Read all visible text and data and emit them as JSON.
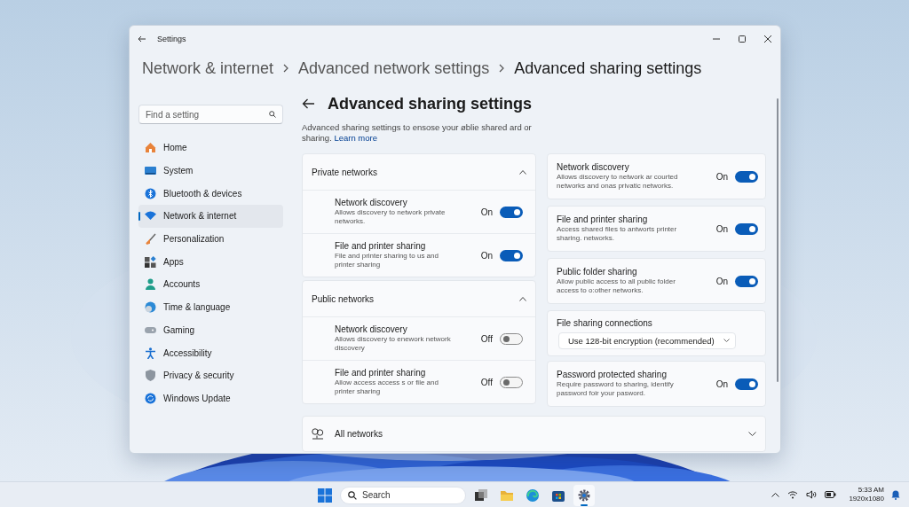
{
  "window": {
    "title": "Settings"
  },
  "breadcrumb": [
    "Network & internet",
    "Advanced network settings",
    "Advanced sharing settings"
  ],
  "sidebar": {
    "search": {
      "placeholder": "Find a setting"
    },
    "items": [
      {
        "label": "Home",
        "selected": false
      },
      {
        "label": "System",
        "selected": false
      },
      {
        "label": "Bluetooth & devices",
        "selected": false
      },
      {
        "label": "Network & internet",
        "selected": true
      },
      {
        "label": "Personalization",
        "selected": false
      },
      {
        "label": "Apps",
        "selected": false
      },
      {
        "label": "Accounts",
        "selected": false
      },
      {
        "label": "Time & language",
        "selected": false
      },
      {
        "label": "Gaming",
        "selected": false
      },
      {
        "label": "Accessibility",
        "selected": false
      },
      {
        "label": "Privacy & security",
        "selected": false
      },
      {
        "label": "Windows Update",
        "selected": false
      }
    ]
  },
  "page": {
    "title": "Advanced sharing settings",
    "description": "Advanced sharing settings to ensose your øblie shared ard or sharing.",
    "link": "Learn more"
  },
  "sections": [
    {
      "title": "Private networks",
      "expanded": true,
      "items": [
        {
          "title": "Network discovery",
          "description": "Allows discovery to network private networks.",
          "state_label": "On",
          "on": true
        },
        {
          "title": "File and printer sharing",
          "description": "File and printer sharing to us and printer sharing",
          "state_label": "On",
          "on": true
        }
      ]
    },
    {
      "title": "Public networks",
      "expanded": true,
      "items": [
        {
          "title": "Network discovery",
          "description": "Allows discovery to enework network discovery",
          "state_label": "Off",
          "on": false
        },
        {
          "title": "File and printer sharing",
          "description": "Allow access access s or file and printer sharing",
          "state_label": "Off",
          "on": false
        }
      ]
    }
  ],
  "cards": [
    {
      "kind": "toggle",
      "title": "Network discovery",
      "description": "Allows discovery to network ar courted networks and onas privatic networks.",
      "state_label": "On",
      "on": true
    },
    {
      "kind": "toggle",
      "title": "File and printer sharing",
      "description": "Access shared files to antworts printer sharing. networks.",
      "state_label": "On",
      "on": true
    },
    {
      "kind": "toggle",
      "title": "Public folder sharing",
      "description": "Allow public access to all public folder access to o:other networks.",
      "state_label": "On",
      "on": true
    },
    {
      "kind": "dropdown",
      "title": "File sharing connections",
      "value": "Use 128-bit encryption (recommended)"
    },
    {
      "kind": "toggle",
      "title": "Password protected sharing",
      "description": "Require password to sharing, identify password foir your pasword.",
      "state_label": "On",
      "on": true
    }
  ],
  "all_networks": {
    "title": "All networks",
    "expanded": false
  },
  "taskbar": {
    "search": {
      "placeholder": "Search"
    },
    "apps": [
      {
        "kind": "task-view",
        "selected": false
      },
      {
        "kind": "folder",
        "selected": false
      },
      {
        "kind": "browser",
        "selected": false
      },
      {
        "kind": "store",
        "selected": false
      },
      {
        "kind": "settings",
        "selected": true
      }
    ],
    "time": "5:33 AM",
    "date": "1920x1080"
  }
}
